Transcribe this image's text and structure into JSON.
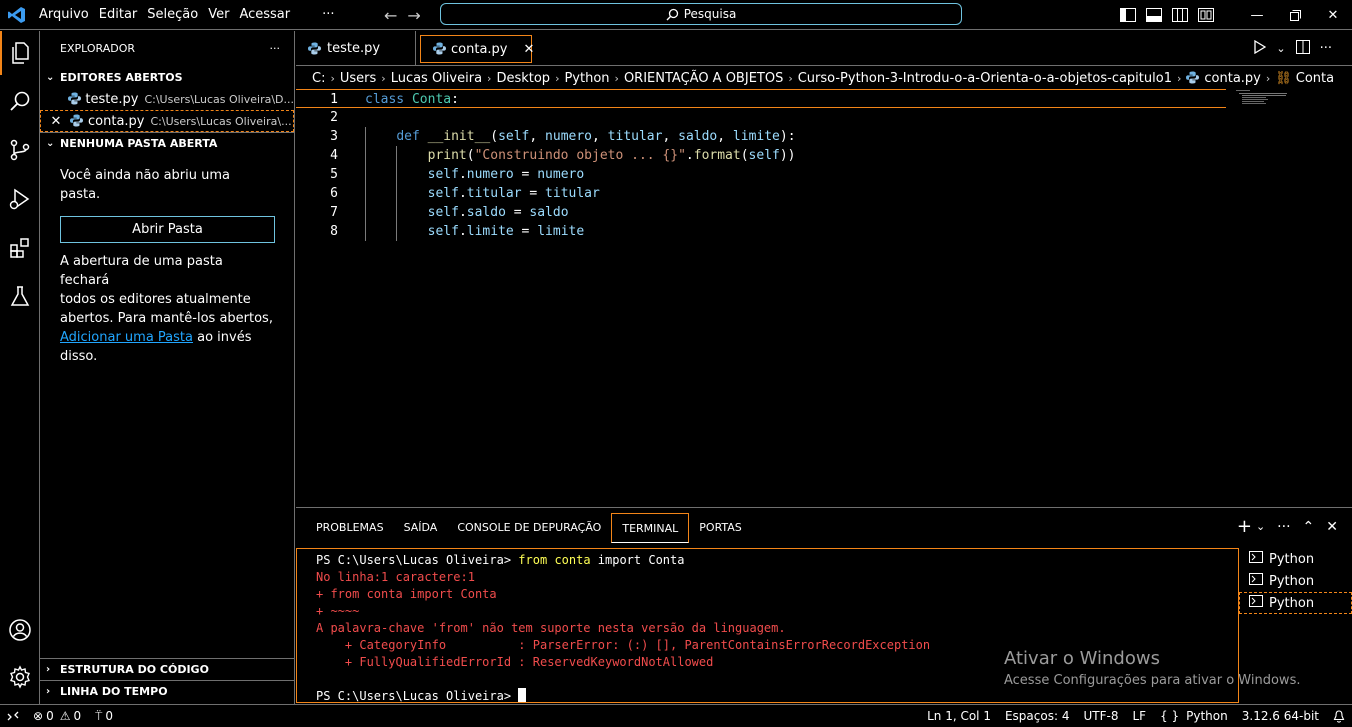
{
  "menu": {
    "items": [
      "Arquivo",
      "Editar",
      "Seleção",
      "Ver",
      "Acessar"
    ],
    "more": "···"
  },
  "search": {
    "placeholder": "Pesquisa"
  },
  "explorer": {
    "title": "EXPLORADOR",
    "more": "···",
    "open_editors": {
      "header": "EDITORES ABERTOS",
      "items": [
        {
          "name": "teste.py",
          "path": "C:\\Users\\Lucas Oliveira\\D..."
        },
        {
          "name": "conta.py",
          "path": "C:\\Users\\Lucas Oliveira\\..."
        }
      ]
    },
    "no_folder": {
      "header": "NENHUMA PASTA ABERTA",
      "message": "Você ainda não abriu uma pasta.",
      "button": "Abrir Pasta",
      "info_line1": "A abertura de uma pasta fechará",
      "info_line2": "todos os editores atualmente",
      "info_line3": "abertos. Para mantê-los abertos,",
      "info_link": "Adicionar uma Pasta",
      "info_tail": " ao invés disso."
    },
    "outline_header": "ESTRUTURA DO CÓDIGO",
    "timeline_header": "LINHA DO TEMPO"
  },
  "tabs": [
    {
      "label": "teste.py"
    },
    {
      "label": "conta.py",
      "close": "✕"
    }
  ],
  "breadcrumb": [
    "C:",
    "Users",
    "Lucas Oliveira",
    "Desktop",
    "Python",
    "ORIENTAÇÃO A OBJETOS",
    "Curso-Python-3-Introdu-o-a-Orienta-o-a-objetos-capitulo1",
    "conta.py",
    "Conta"
  ],
  "code": {
    "line_numbers": [
      "1",
      "2",
      "3",
      "4",
      "5",
      "6",
      "7",
      "8"
    ]
  },
  "panel": {
    "tabs": [
      "PROBLEMAS",
      "SAÍDA",
      "CONSOLE DE DEPURAÇÃO",
      "TERMINAL",
      "PORTAS"
    ],
    "terminal": {
      "prompt1": "PS C:\\Users\\Lucas Oliveira> ",
      "cmd_from": "from",
      "cmd_conta": "conta",
      "cmd_rest": " import Conta",
      "errors": [
        "No linha:1 caractere:1",
        "+ from conta import Conta",
        "+ ~~~~",
        "A palavra-chave 'from' não tem suporte nesta versão da linguagem.",
        "    + CategoryInfo          : ParserError: (:) [], ParentContainsErrorRecordException",
        "    + FullyQualifiedErrorId : ReservedKeywordNotAllowed"
      ],
      "prompt2": "PS C:\\Users\\Lucas Oliveira> "
    },
    "terminal_list": [
      "Python",
      "Python",
      "Python"
    ]
  },
  "watermark": {
    "title": "Ativar o Windows",
    "subtitle": "Acesse Configurações para ativar o Windows."
  },
  "status": {
    "errors": "0",
    "warnings": "0",
    "ports": "0",
    "position": "Ln 1, Col 1",
    "spaces": "Espaços: 4",
    "encoding": "UTF-8",
    "eol": "LF",
    "language_prefix": "{ }",
    "language": "Python",
    "interpreter": "3.12.6 64-bit"
  },
  "colors": {
    "accent": "#f38518",
    "focus_border": "#6fc3df",
    "link": "#21a6ff",
    "error_text": "#f14c4c"
  }
}
